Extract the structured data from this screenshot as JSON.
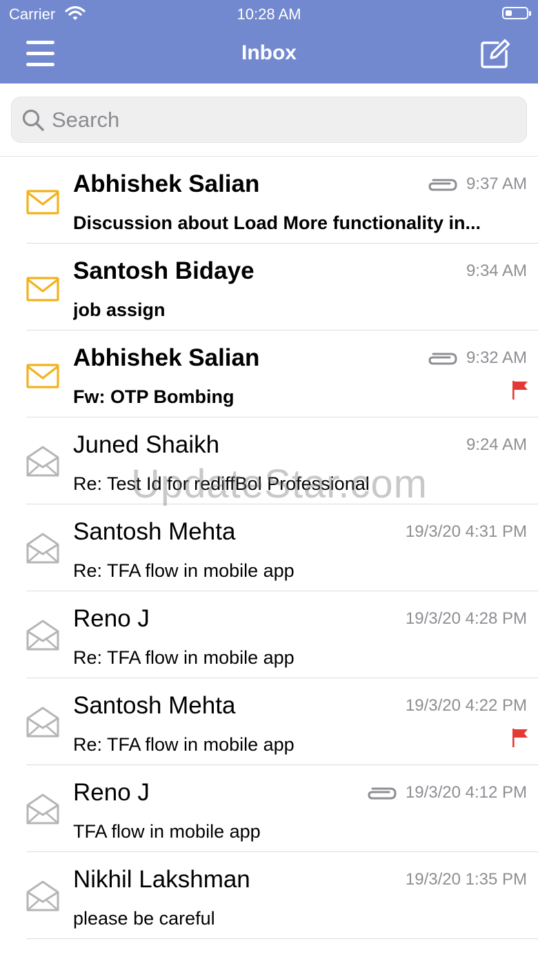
{
  "status_bar": {
    "carrier": "Carrier",
    "time": "10:28 AM",
    "battery_level": 0.3
  },
  "navbar": {
    "title": "Inbox"
  },
  "search": {
    "placeholder": "Search"
  },
  "messages": [
    {
      "sender": "Abhishek Salian",
      "subject": "Discussion about Load More functionality in...",
      "time": "9:37 AM",
      "unread": true,
      "attachment": true,
      "flagged": false
    },
    {
      "sender": "Santosh Bidaye",
      "subject": "job assign",
      "time": "9:34 AM",
      "unread": true,
      "attachment": false,
      "flagged": false
    },
    {
      "sender": "Abhishek Salian",
      "subject": "Fw: OTP Bombing",
      "time": "9:32 AM",
      "unread": true,
      "attachment": true,
      "flagged": true
    },
    {
      "sender": "Juned Shaikh",
      "subject": "Re: Test Id for rediffBol Professional",
      "time": "9:24 AM",
      "unread": false,
      "attachment": false,
      "flagged": false
    },
    {
      "sender": "Santosh Mehta",
      "subject": "Re: TFA flow in mobile app",
      "time": "19/3/20 4:31 PM",
      "unread": false,
      "attachment": false,
      "flagged": false
    },
    {
      "sender": "Reno J",
      "subject": "Re: TFA flow in mobile app",
      "time": "19/3/20 4:28 PM",
      "unread": false,
      "attachment": false,
      "flagged": false
    },
    {
      "sender": "Santosh Mehta",
      "subject": "Re: TFA flow in mobile app",
      "time": "19/3/20 4:22 PM",
      "unread": false,
      "attachment": false,
      "flagged": true
    },
    {
      "sender": "Reno J",
      "subject": "TFA flow in mobile app",
      "time": "19/3/20 4:12 PM",
      "unread": false,
      "attachment": true,
      "flagged": false
    },
    {
      "sender": "Nikhil Lakshman",
      "subject": "please be careful",
      "time": "19/3/20 1:35 PM",
      "unread": false,
      "attachment": false,
      "flagged": false
    }
  ],
  "watermark": "UpdateStar.com",
  "colors": {
    "header": "#7289cf",
    "unread_envelope": "#f2b21c",
    "read_envelope": "#b5b5b5",
    "flag": "#e53935",
    "time_text": "#8e8e93"
  }
}
